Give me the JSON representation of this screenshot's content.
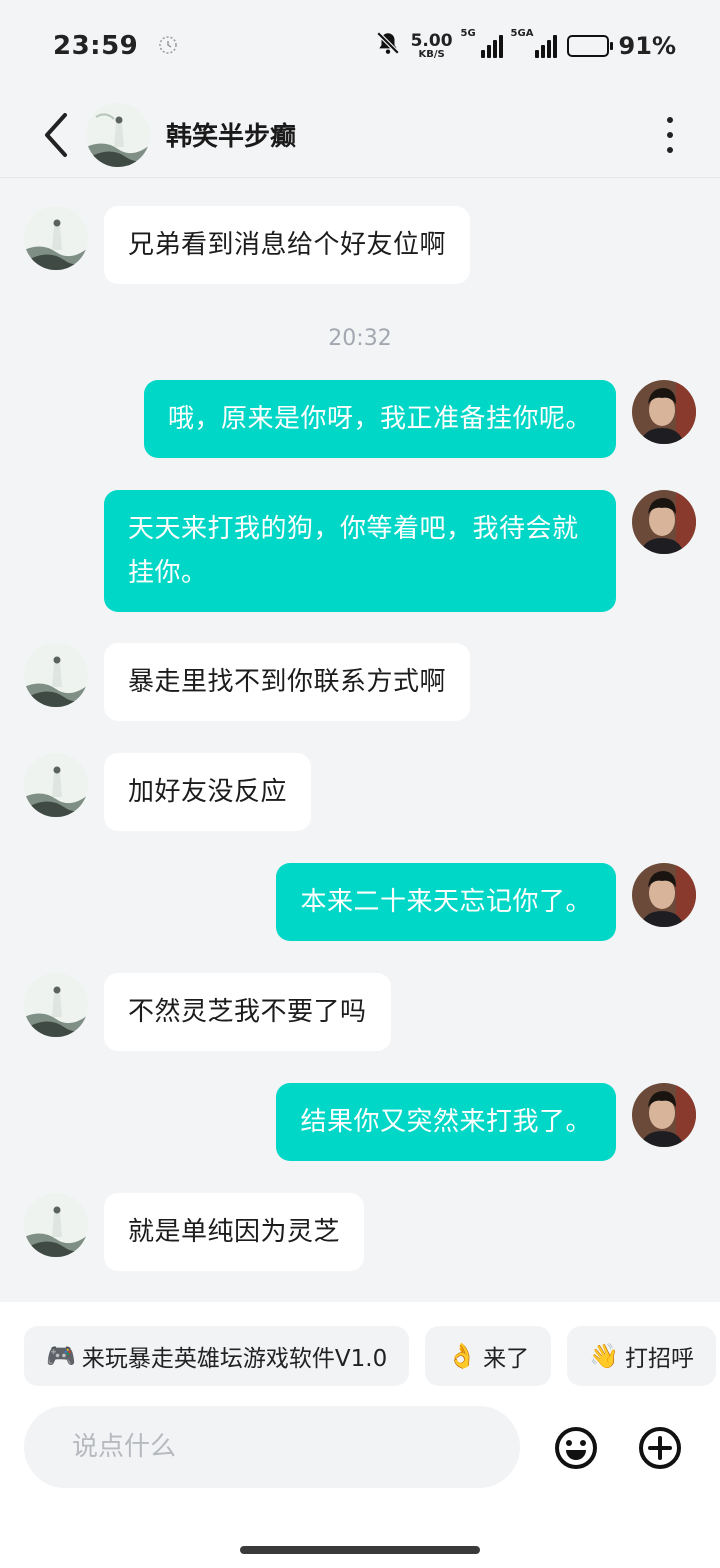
{
  "status_bar": {
    "time": "23:59",
    "net_speed_value": "5.00",
    "net_speed_unit": "KB/S",
    "signal1_label": "5G",
    "signal2_label": "5GA",
    "battery": "91%"
  },
  "header": {
    "contact_name": "韩笑半步癫"
  },
  "timestamp": "20:32",
  "messages": [
    {
      "side": "in",
      "text": "兄弟看到消息给个好友位啊"
    },
    {
      "side": "out",
      "text": "哦，原来是你呀，我正准备挂你呢。"
    },
    {
      "side": "out",
      "text": "天天来打我的狗，你等着吧，我待会就挂你。"
    },
    {
      "side": "in",
      "text": "暴走里找不到你联系方式啊"
    },
    {
      "side": "in",
      "text": "加好友没反应"
    },
    {
      "side": "out",
      "text": "本来二十来天忘记你了。"
    },
    {
      "side": "in",
      "text": "不然灵芝我不要了吗"
    },
    {
      "side": "out",
      "text": "结果你又突然来打我了。"
    },
    {
      "side": "in",
      "text": "就是单纯因为灵芝"
    }
  ],
  "quick_replies": [
    {
      "emoji": "🎮",
      "label": "来玩暴走英雄坛游戏软件V1.0"
    },
    {
      "emoji": "👌",
      "label": "来了"
    },
    {
      "emoji": "👋",
      "label": "打招呼"
    }
  ],
  "input": {
    "placeholder": "说点什么"
  },
  "colors": {
    "outgoing_bubble": "#00d7c7",
    "incoming_bubble": "#ffffff",
    "background": "#f3f4f6"
  }
}
